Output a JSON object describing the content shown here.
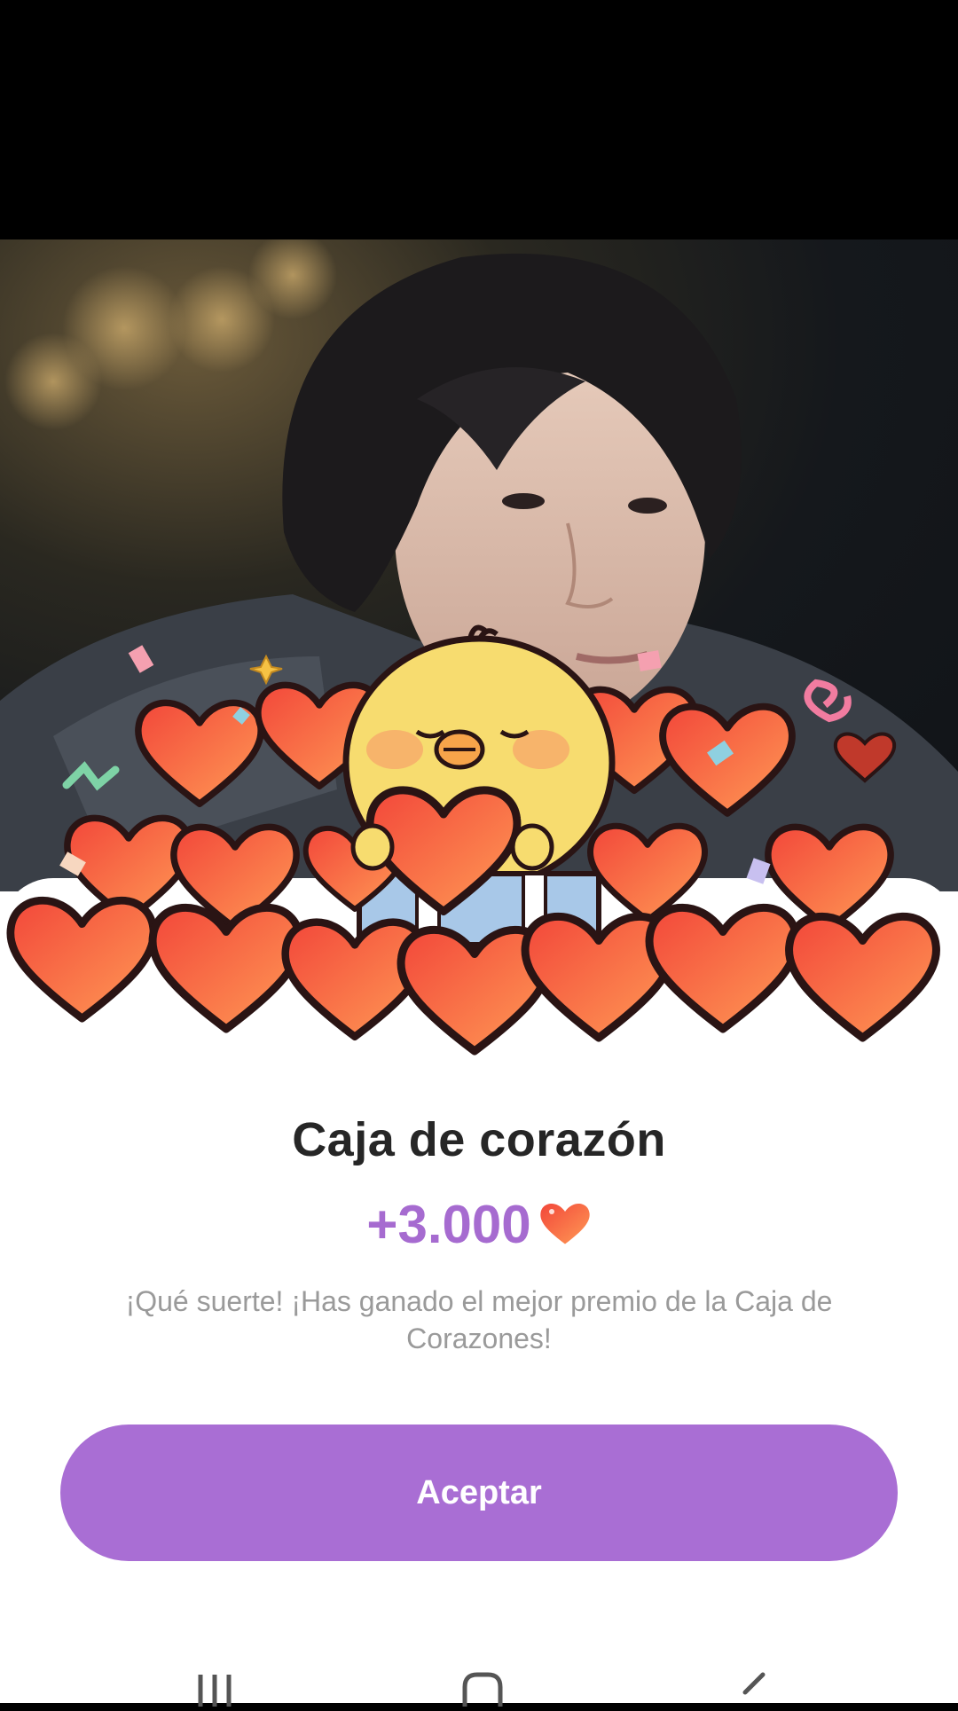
{
  "dialog": {
    "title": "Caja de corazón",
    "reward_amount": "+3.000",
    "reward_icon": "heart-icon",
    "message": "¡Qué suerte! ¡Has ganado el mejor premio de la Caja de Corazones!",
    "accept_label": "Aceptar"
  },
  "nav": {
    "recents_icon": "recents-icon",
    "home_icon": "home-icon",
    "back_icon": "back-icon"
  },
  "colors": {
    "accent": "#a96ed4",
    "reward_text": "#a66bd0",
    "heart": "#f0553a",
    "chick": "#f7dc6f"
  }
}
